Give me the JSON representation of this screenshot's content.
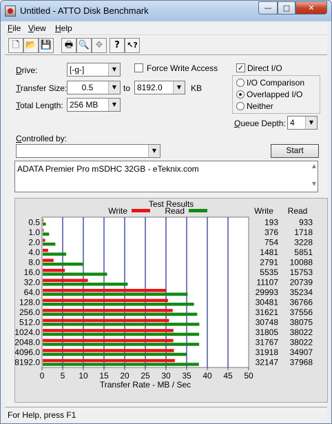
{
  "window": {
    "title": "Untitled - ATTO Disk Benchmark",
    "controls": {
      "minimize": "—",
      "maximize": "□",
      "close": "✕"
    }
  },
  "menu": [
    "File",
    "View",
    "Help"
  ],
  "toolbar": [
    "new-doc-icon",
    "open-folder-icon",
    "save-disk-icon",
    "print-icon",
    "print-preview-icon",
    "move-icon",
    "help-icon",
    "context-help-icon"
  ],
  "toolbar_glyphs": [
    "🗋",
    "📂",
    "💾",
    "🖶",
    "🔍",
    "✥",
    "?",
    "↖?"
  ],
  "drive": {
    "label": "Drive:",
    "value": "[-g-]"
  },
  "force_write_access": {
    "label": "Force Write Access",
    "checked": false
  },
  "direct_io": {
    "label": "Direct I/O",
    "checked": true,
    "mark": "✓"
  },
  "transfer_size": {
    "label": "Transfer Size:",
    "from": "0.5",
    "to_label": "to",
    "to": "8192.0",
    "unit": "KB"
  },
  "total_length": {
    "label": "Total Length:",
    "value": "256 MB"
  },
  "io_mode": {
    "options": [
      "I/O Comparison",
      "Overlapped I/O",
      "Neither"
    ],
    "selected": "Overlapped I/O"
  },
  "queue_depth": {
    "label": "Queue Depth:",
    "value": "4"
  },
  "controlled_by": {
    "label": "Controlled by:",
    "value": ""
  },
  "start_button": "Start",
  "description": "ADATA Premier Pro mSDHC 32GB - eTeknix.com",
  "results": {
    "title": "Test Results",
    "write_col": "Write",
    "read_col": "Read"
  },
  "colors": {
    "write": "#e8141a",
    "read": "#138a13",
    "grid": "#1a2a8a"
  },
  "chart_data": {
    "type": "bar",
    "orientation": "horizontal",
    "categories": [
      "0.5",
      "1.0",
      "2.0",
      "4.0",
      "8.0",
      "16.0",
      "32.0",
      "64.0",
      "128.0",
      "256.0",
      "512.0",
      "1024.0",
      "2048.0",
      "4096.0",
      "8192.0"
    ],
    "series": [
      {
        "name": "Write",
        "values": [
          193,
          376,
          754,
          1481,
          2791,
          5535,
          11107,
          29993,
          30481,
          31621,
          30748,
          31805,
          31767,
          31918,
          32147
        ]
      },
      {
        "name": "Read",
        "values": [
          933,
          1718,
          3228,
          5851,
          10088,
          15753,
          20739,
          35234,
          36766,
          37556,
          38075,
          38022,
          38022,
          34907,
          37968
        ]
      }
    ],
    "xlabel": "Transfer Rate - MB / Sec",
    "xticks": [
      "0",
      "5",
      "10",
      "15",
      "20",
      "25",
      "30",
      "35",
      "40",
      "45",
      "50"
    ],
    "xlim": [
      0,
      50
    ],
    "grid": true
  },
  "status": "For Help, press F1"
}
